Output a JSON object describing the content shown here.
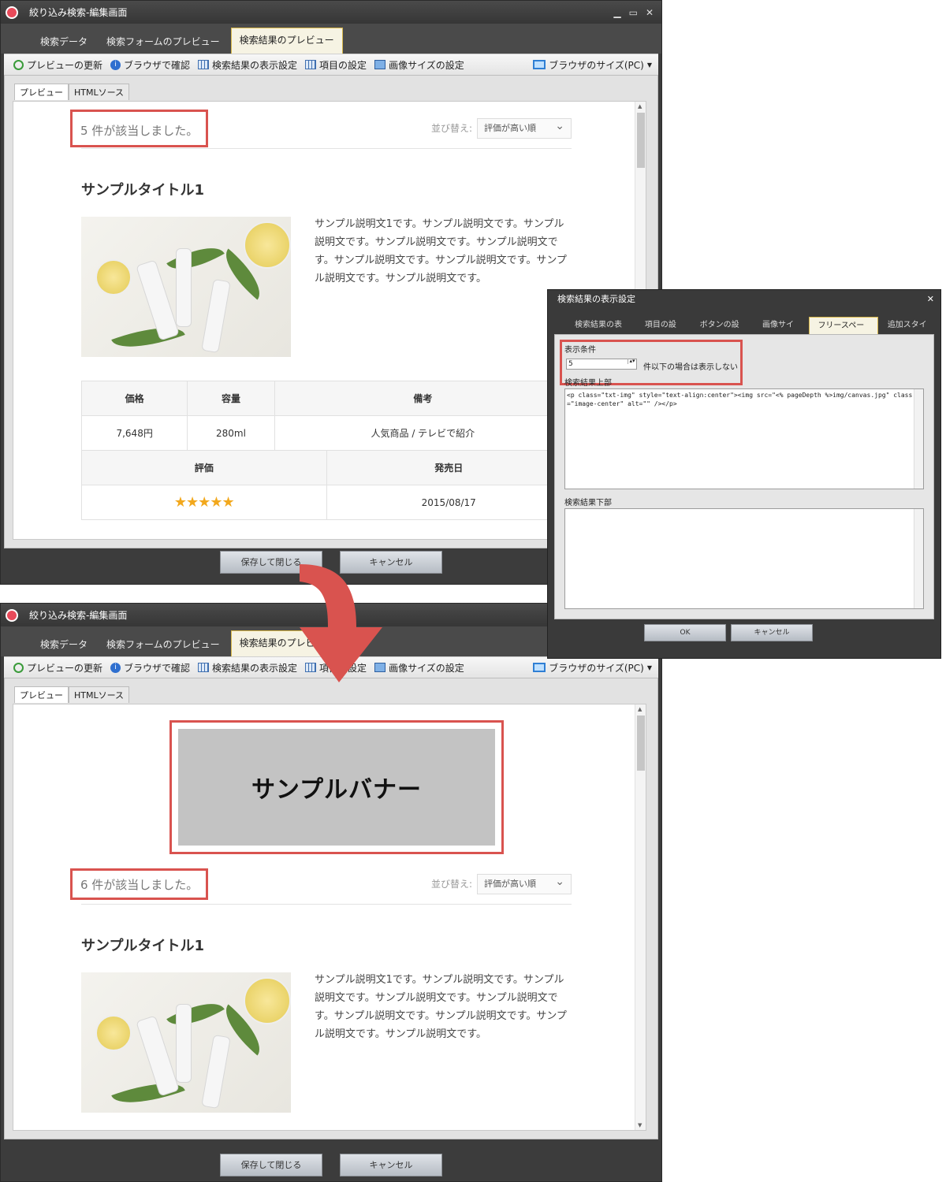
{
  "window_title": "絞り込み検索-編集画面",
  "main_tabs": [
    "検索データ",
    "検索フォームのプレビュー",
    "検索結果のプレビュー"
  ],
  "toolbar": {
    "refresh": "プレビューの更新",
    "browser_check": "ブラウザで確認",
    "result_display": "検索結果の表示設定",
    "item_settings": "項目の設定",
    "image_size": "画像サイズの設定",
    "browser_size": "ブラウザのサイズ(PC)"
  },
  "sub_tabs": [
    "プレビュー",
    "HTMLソース"
  ],
  "top_preview": {
    "count_text": "5 件が該当しました。",
    "sort_label": "並び替え:",
    "sort_value": "評価が高い順",
    "product_title": "サンプルタイトル1",
    "description": "サンプル説明文1です。サンプル説明文です。サンプル説明文です。サンプル説明文です。サンプル説明文です。サンプル説明文です。サンプル説明文です。サンプル説明文です。サンプル説明文です。",
    "table": {
      "headers1": [
        "価格",
        "容量",
        "備考"
      ],
      "values1": [
        "7,648円",
        "280ml",
        "人気商品 /  テレビで紹介"
      ],
      "headers2": [
        "評価",
        "発売日"
      ],
      "rating_stars": "★★★★★",
      "rating_value": 5,
      "release_date": "2015/08/17"
    }
  },
  "bottom_preview": {
    "banner_text": "サンプルバナー",
    "count_text": "6 件が該当しました。",
    "sort_label": "並び替え:",
    "sort_value": "評価が高い順",
    "product_title": "サンプルタイトル1",
    "description": "サンプル説明文1です。サンプル説明文です。サンプル説明文です。サンプル説明文です。サンプル説明文です。サンプル説明文です。サンプル説明文です。サンプル説明文です。サンプル説明文です。"
  },
  "buttons": {
    "save_close": "保存して閉じる",
    "cancel": "キャンセル"
  },
  "dialog": {
    "title": "検索結果の表示設定",
    "tabs": [
      "検索結果の表示",
      "項目の設定",
      "ボタンの設定",
      "画像サイズ",
      "フリースペース",
      "追加スタイル"
    ],
    "condition_label": "表示条件",
    "condition_value": "5",
    "condition_suffix": "件以下の場合は表示しない",
    "upper_label": "検索結果上部",
    "upper_code": "<p class=\"txt-img\" style=\"text-align:center\"><img src=\"<% pageDepth %>img/canvas.jpg\" class=\"image-center\" alt=\"\" /></p>",
    "lower_label": "検索結果下部",
    "ok": "OK",
    "cancel": "キャンセル"
  }
}
